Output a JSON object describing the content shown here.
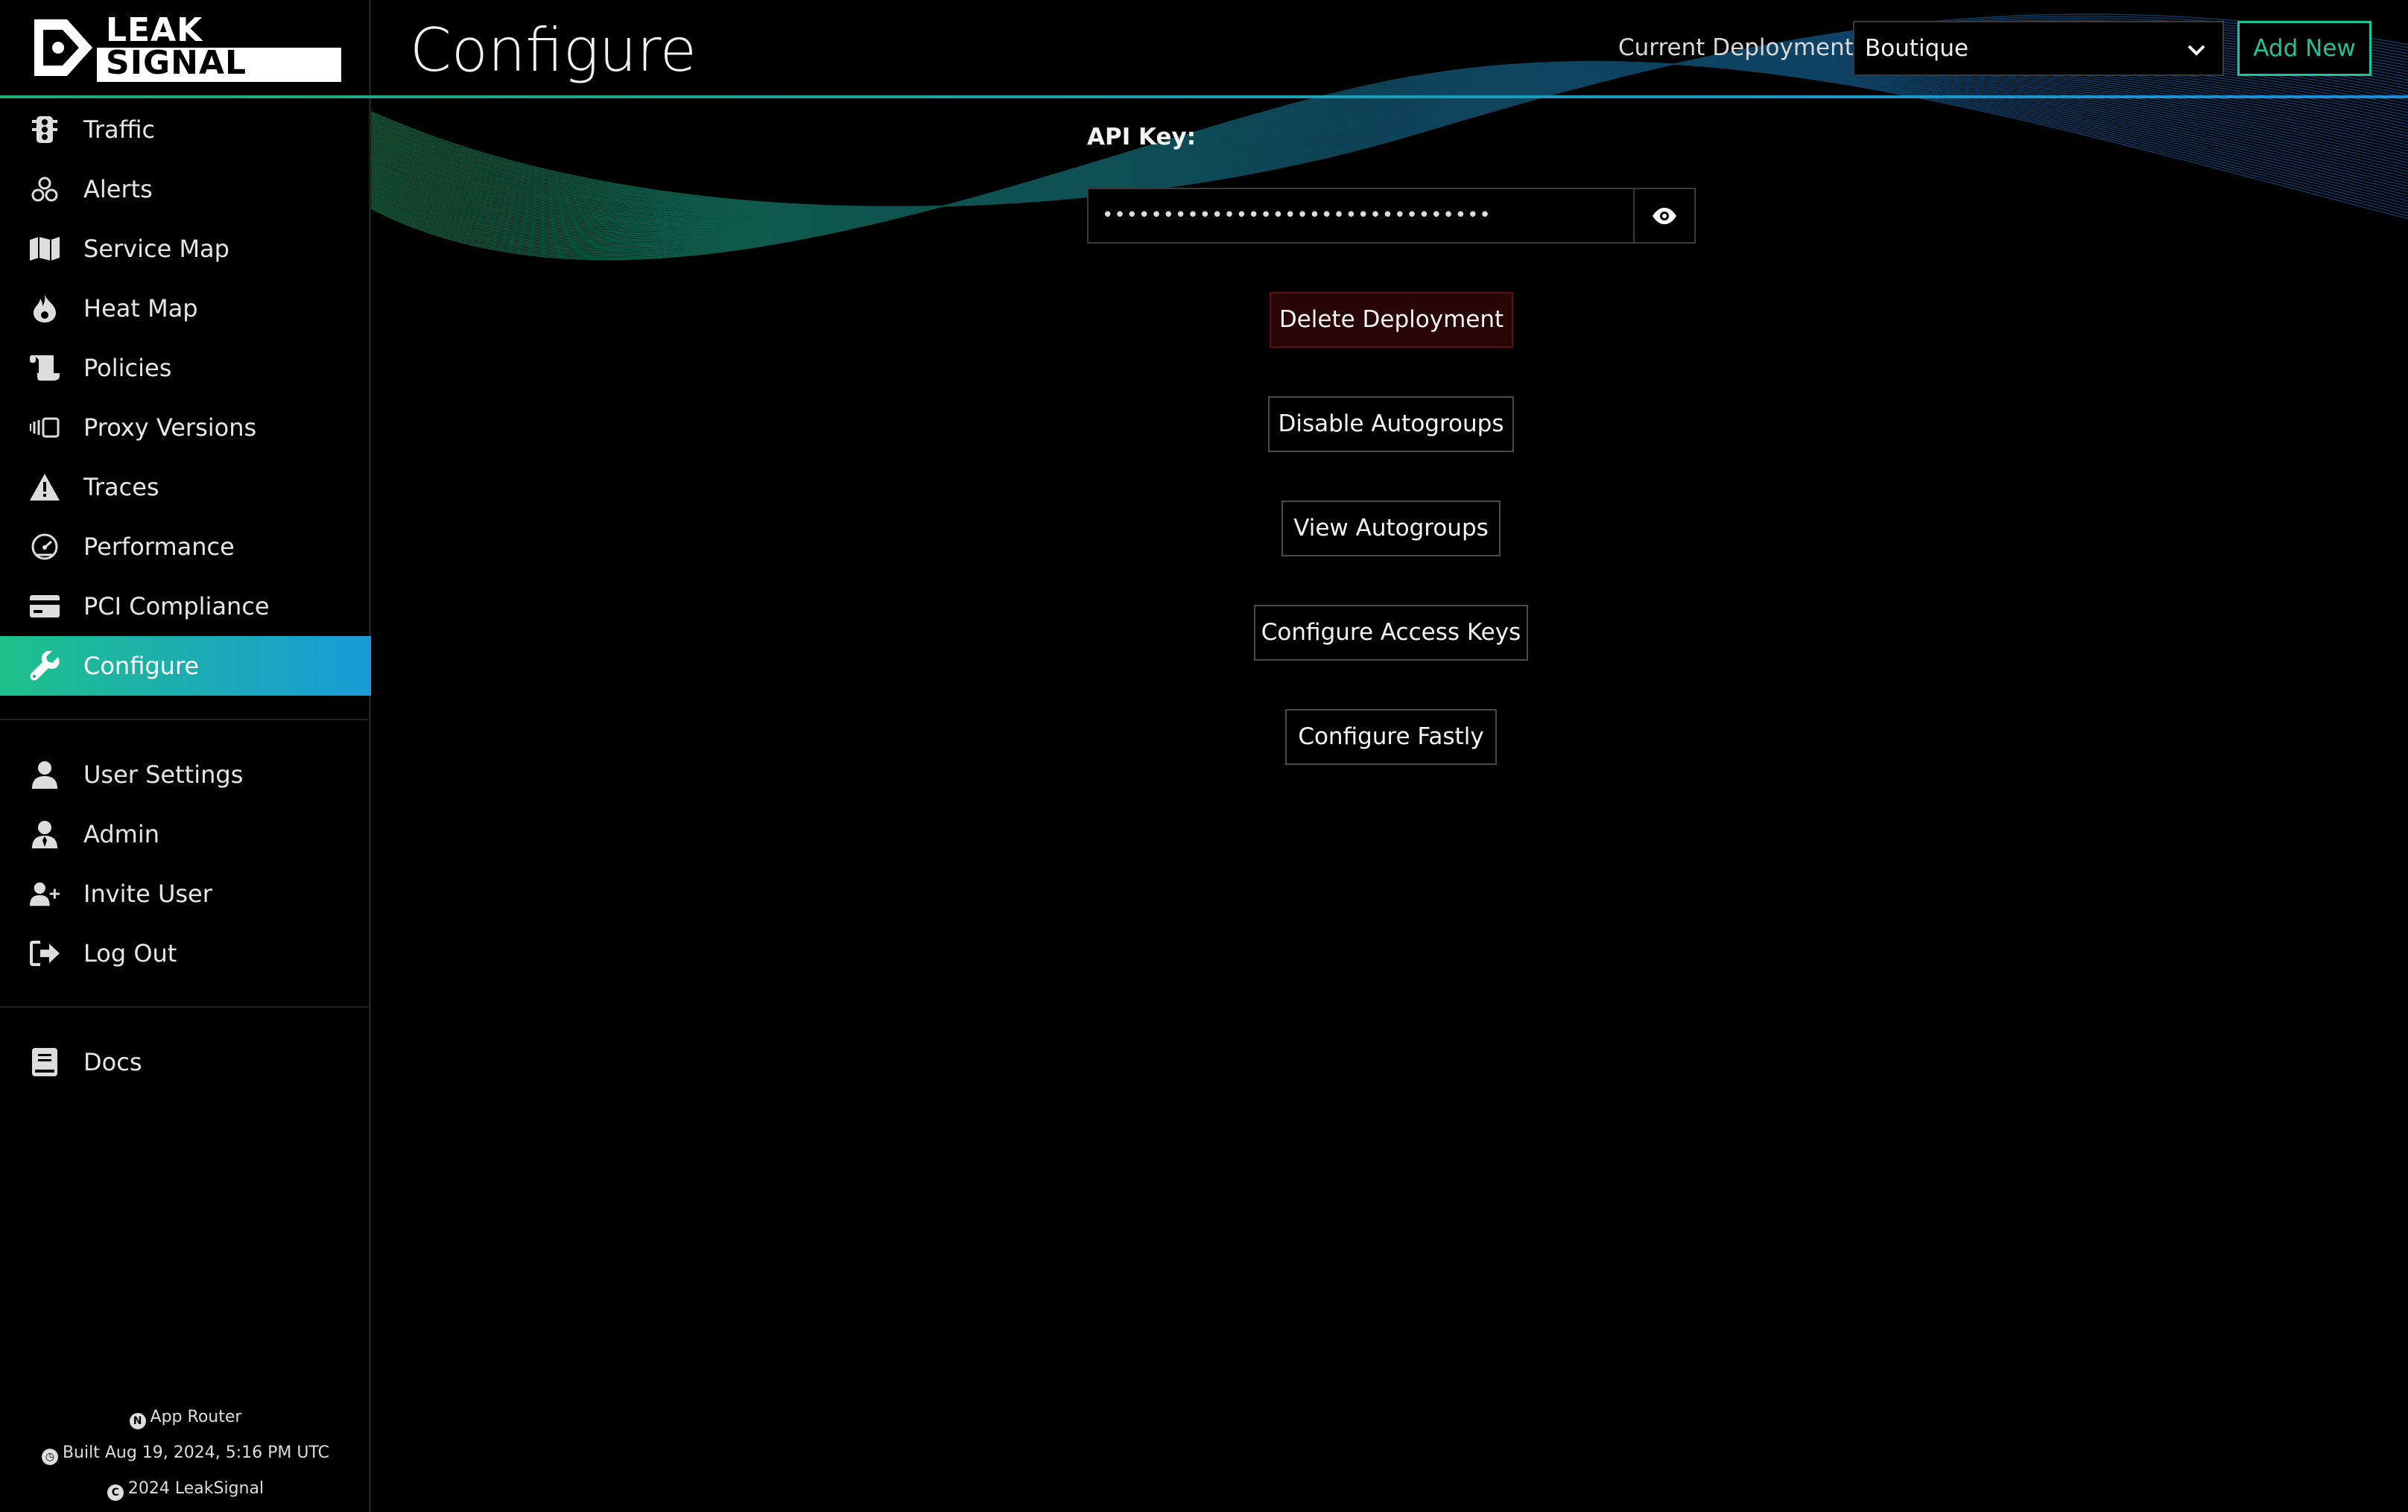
{
  "brand": {
    "logo_line1": "LEAK",
    "logo_line2": "SIGNAL"
  },
  "header": {
    "title": "Configure",
    "deployment_label": "Current Deployment:",
    "deployment_value": "Boutique",
    "add_new_label": "Add New"
  },
  "sidebar": {
    "main_items": [
      {
        "label": "Traffic",
        "icon": "traffic-light-icon"
      },
      {
        "label": "Alerts",
        "icon": "alerts-icon"
      },
      {
        "label": "Service Map",
        "icon": "map-icon"
      },
      {
        "label": "Heat Map",
        "icon": "fire-icon"
      },
      {
        "label": "Policies",
        "icon": "scroll-icon"
      },
      {
        "label": "Proxy Versions",
        "icon": "proxy-versions-icon"
      },
      {
        "label": "Traces",
        "icon": "warning-triangle-icon"
      },
      {
        "label": "Performance",
        "icon": "gauge-icon"
      },
      {
        "label": "PCI Compliance",
        "icon": "credit-card-icon"
      },
      {
        "label": "Configure",
        "icon": "wrench-icon",
        "active": true
      }
    ],
    "user_items": [
      {
        "label": "User Settings",
        "icon": "user-icon"
      },
      {
        "label": "Admin",
        "icon": "admin-user-icon"
      },
      {
        "label": "Invite User",
        "icon": "user-plus-icon"
      },
      {
        "label": "Log Out",
        "icon": "logout-icon"
      }
    ],
    "doc_items": [
      {
        "label": "Docs",
        "icon": "book-icon"
      }
    ],
    "footer": {
      "router": "App Router",
      "built": "Built Aug 19, 2024, 5:16 PM UTC",
      "copyright": "2024 LeakSignal"
    }
  },
  "main": {
    "api_key_label": "API Key:",
    "api_key_masked": "••••••••••••••••••••••••••••••••",
    "actions": {
      "delete_deployment": "Delete Deployment",
      "disable_autogroups": "Disable Autogroups",
      "view_autogroups": "View Autogroups",
      "configure_access_keys": "Configure Access Keys",
      "configure_fastly": "Configure Fastly"
    }
  },
  "colors": {
    "accent_green": "#1fc39a",
    "accent_blue": "#1a9bd8",
    "danger_bg": "#2a0505",
    "background": "#000000"
  }
}
